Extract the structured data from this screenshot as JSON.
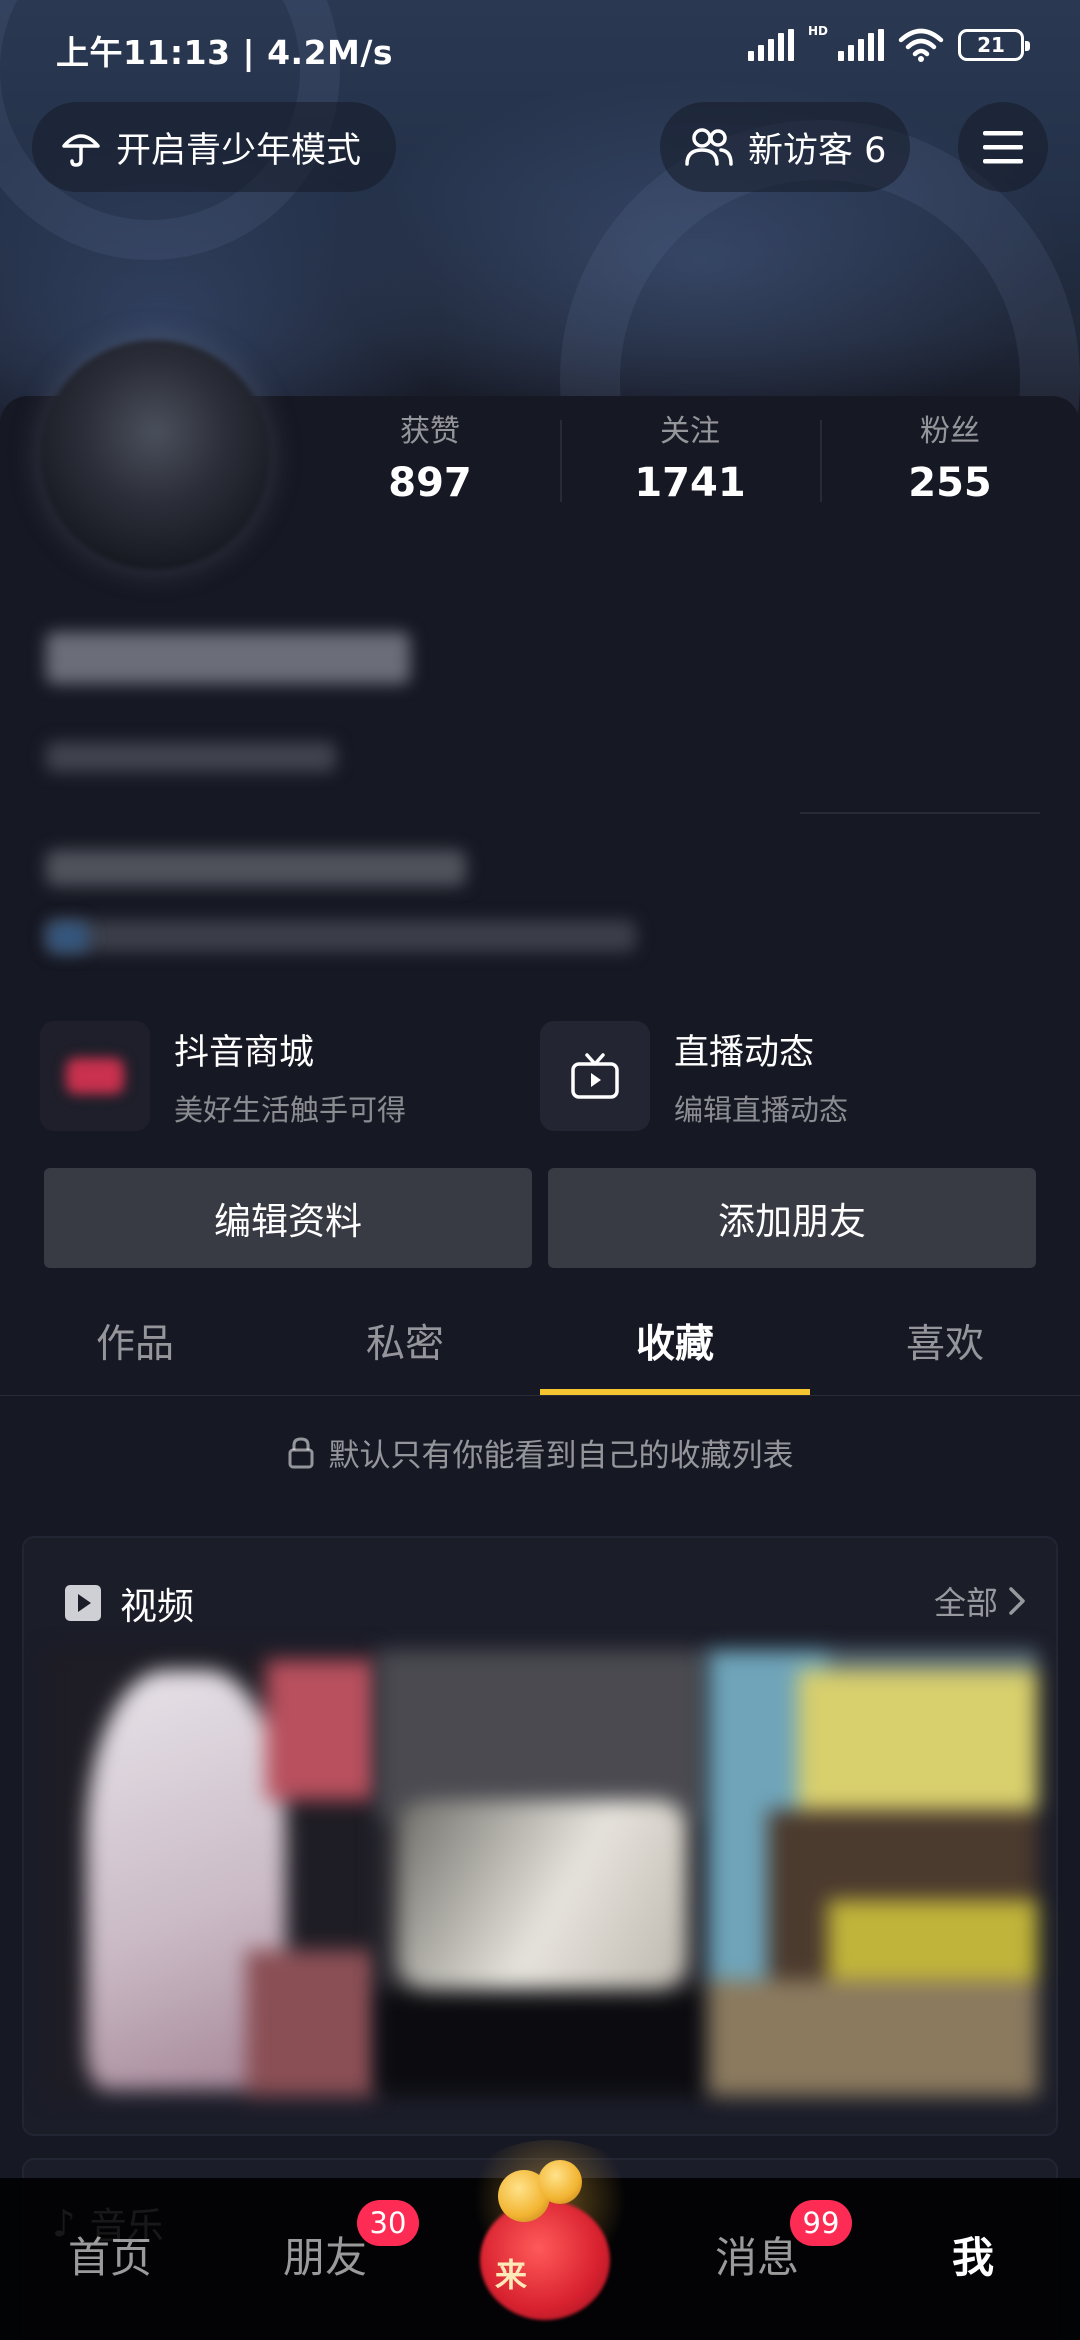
{
  "status_bar": {
    "time": "上午11:13 | 4.2M/s",
    "battery": "21",
    "network_hd": "HD"
  },
  "top_bar": {
    "teen_mode_label": "开启青少年模式",
    "visitor_label": "新访客 6"
  },
  "stats": [
    {
      "label": "获赞",
      "value": "897"
    },
    {
      "label": "关注",
      "value": "1741"
    },
    {
      "label": "粉丝",
      "value": "255"
    }
  ],
  "shortcuts": [
    {
      "title": "抖音商城",
      "subtitle": "美好生活触手可得",
      "icon": "shop-icon"
    },
    {
      "title": "直播动态",
      "subtitle": "编辑直播动态",
      "icon": "tv-icon"
    }
  ],
  "actions": {
    "edit_profile": "编辑资料",
    "add_friend": "添加朋友"
  },
  "tabs": [
    {
      "label": "作品",
      "active": false
    },
    {
      "label": "私密",
      "active": false
    },
    {
      "label": "收藏",
      "active": true
    },
    {
      "label": "喜欢",
      "active": false
    }
  ],
  "privacy_note": "默认只有你能看到自己的收藏列表",
  "favorites": {
    "section_title": "视频",
    "see_all": "全部",
    "music_title": "音乐"
  },
  "bottom_nav": [
    {
      "label": "首页",
      "badge": null,
      "active": false
    },
    {
      "label": "朋友",
      "badge": "30",
      "active": false
    },
    {
      "label": "来",
      "badge": null,
      "active": false
    },
    {
      "label": "消息",
      "badge": "99",
      "active": false
    },
    {
      "label": "我",
      "badge": null,
      "active": true
    }
  ],
  "colors": {
    "background": "#161823",
    "accent_tab": "#f5c531",
    "badge": "#fe2c55",
    "button": "#393b44"
  }
}
